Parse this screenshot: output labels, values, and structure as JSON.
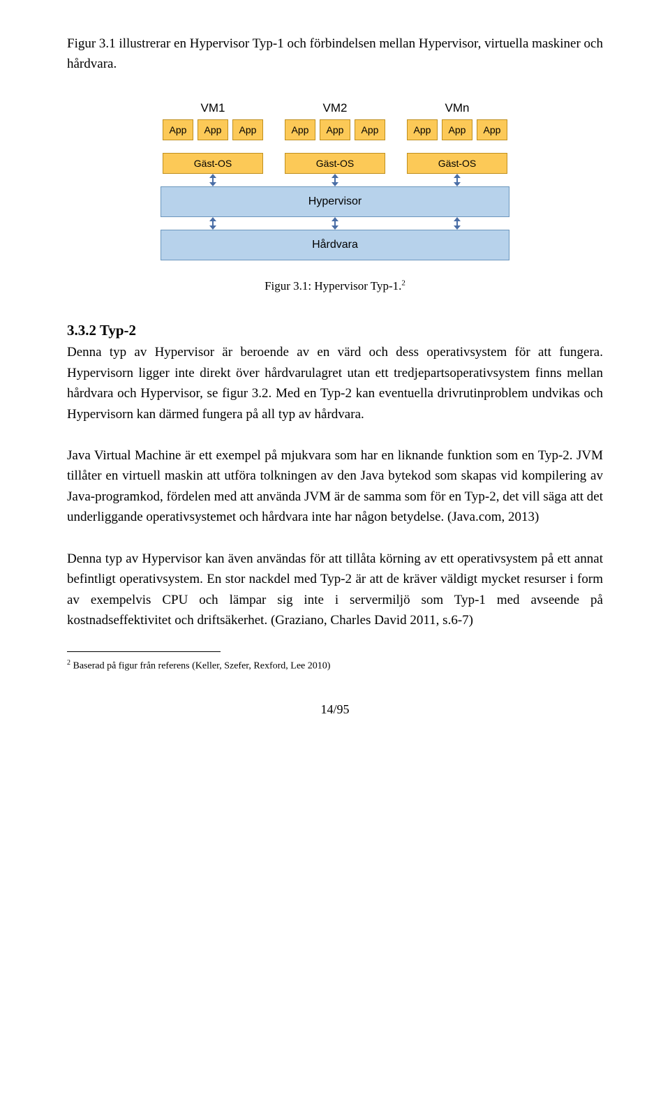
{
  "intro": "Figur 3.1 illustrerar en Hypervisor Typ-1 och förbindelsen mellan Hypervisor, virtuella maskiner och hårdvara.",
  "figure": {
    "vms": [
      {
        "name": "VM1",
        "apps": [
          "App",
          "App",
          "App"
        ],
        "gast": "Gäst-OS"
      },
      {
        "name": "VM2",
        "apps": [
          "App",
          "App",
          "App"
        ],
        "gast": "Gäst-OS"
      },
      {
        "name": "VMn",
        "apps": [
          "App",
          "App",
          "App"
        ],
        "gast": "Gäst-OS"
      }
    ],
    "hypervisor": "Hypervisor",
    "hardware": "Hårdvara",
    "caption": "Figur 3.1: Hypervisor Typ-1.",
    "caption_sup": "2"
  },
  "section": {
    "heading": "3.3.2 Typ-2",
    "p1": "Denna typ av Hypervisor är beroende av en värd och dess operativsystem för att fungera. Hypervisorn ligger inte direkt över hårdvarulagret utan ett tredjepartsoperativsystem finns mellan hårdvara och Hypervisor, se figur 3.2. Med en Typ-2 kan eventuella drivrutinproblem undvikas och Hypervisorn kan därmed fungera på all typ av hårdvara.",
    "p2": "Java Virtual Machine är ett exempel på mjukvara som har en liknande funktion som en Typ-2. JVM tillåter en virtuell maskin att utföra tolkningen av den Java bytekod som skapas vid kompilering av Java-programkod, fördelen med att använda JVM är de samma som för en Typ-2, det vill säga att det underliggande operativsystemet och hårdvara inte har någon betydelse. (Java.com, 2013)",
    "p3": "Denna typ av Hypervisor kan även användas för att tillåta körning av ett operativsystem på ett annat befintligt operativsystem. En stor nackdel med Typ-2 är att de kräver väldigt mycket resurser i form av exempelvis CPU och lämpar sig inte i servermiljö som Typ-1 med avseende på kostnadseffektivitet och driftsäkerhet. (Graziano, Charles David 2011, s.6-7)"
  },
  "footnote": {
    "sup": "2",
    "text": " Baserad på figur från referens (Keller, Szefer, Rexford, Lee 2010)"
  },
  "pagenum": "14/95"
}
